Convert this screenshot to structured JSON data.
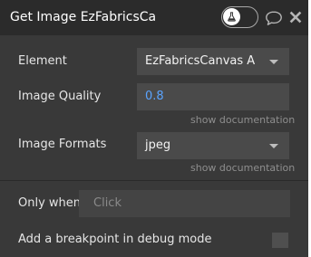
{
  "header": {
    "title": "Get Image EzFabricsCanvas A"
  },
  "fields": {
    "element": {
      "label": "Element",
      "value": "EzFabricsCanvas A"
    },
    "image_quality": {
      "label": "Image Quality",
      "value": "0.8",
      "doc_link": "show documentation"
    },
    "image_formats": {
      "label": "Image Formats",
      "value": "jpeg",
      "doc_link": "show documentation"
    }
  },
  "condition": {
    "label": "Only when",
    "placeholder": "Click"
  },
  "debug": {
    "label": "Add a breakpoint in debug mode"
  },
  "colors": {
    "panel_bg": "#393939",
    "header_bg": "#2b2b2b",
    "field_bg": "#4a4a4a",
    "number_accent": "#5aa4ff"
  },
  "icons": [
    "flask-icon",
    "comment-icon",
    "close-icon",
    "chevron-down-icon"
  ]
}
